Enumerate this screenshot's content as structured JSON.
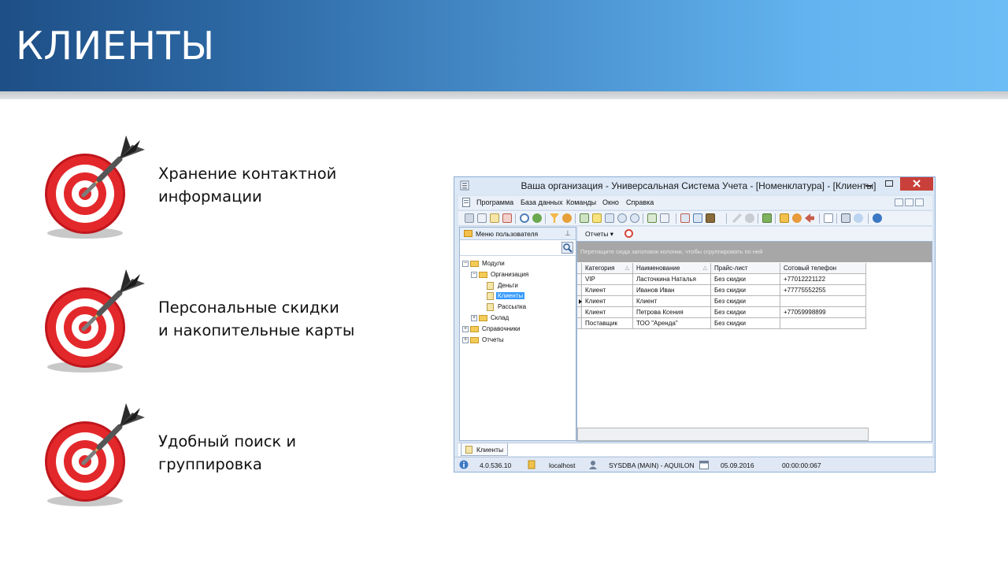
{
  "slide": {
    "title": "КЛИЕНТЫ",
    "bullets": [
      {
        "line1": "Хранение контактной",
        "line2": "информации",
        "icon": "target-dart-icon"
      },
      {
        "line1": "Персональные скидки",
        "line2": "и накопительные карты",
        "icon": "target-dart-icon"
      },
      {
        "line1": "Удобный поиск и",
        "line2": "группировка",
        "icon": "target-dart-icon"
      }
    ]
  },
  "app": {
    "title": "Ваша организация - Универсальная Система Учета - [Номенклатура] - [Клиенты]",
    "menu": [
      "Программа",
      "База данных",
      "Команды",
      "Окно",
      "Справка"
    ],
    "nav_panel": {
      "header": "Меню пользователя",
      "search_value": "",
      "tree": [
        {
          "label": "Модули",
          "level": 0,
          "expander": "−",
          "icon": "folder-open-icon"
        },
        {
          "label": "Организация",
          "level": 1,
          "expander": "−",
          "icon": "folder-open-icon"
        },
        {
          "label": "Деньги",
          "level": 2,
          "expander": "",
          "icon": "document-icon"
        },
        {
          "label": "Клиенты",
          "level": 2,
          "expander": "",
          "icon": "document-icon",
          "selected": true
        },
        {
          "label": "Рассылка",
          "level": 2,
          "expander": "",
          "icon": "document-icon"
        },
        {
          "label": "Склад",
          "level": 1,
          "expander": "+",
          "icon": "folder-icon"
        },
        {
          "label": "Справочники",
          "level": 0,
          "expander": "+",
          "icon": "folder-icon"
        },
        {
          "label": "Отчеты",
          "level": 0,
          "expander": "+",
          "icon": "folder-icon"
        }
      ]
    },
    "reports_label": "Отчеты",
    "group_hint": "Перетащите сюда заголовок колонки, чтобы сгруппировать по ней",
    "grid": {
      "columns": [
        "Категория",
        "Наименование",
        "Прайс-лист",
        "Сотовый телефон"
      ],
      "rows": [
        [
          "VIP",
          "Ласточкина Наталья",
          "Без скидки",
          "+77012221122"
        ],
        [
          "Клиент",
          "Иванов Иван",
          "Без скидки",
          "+77775552255"
        ],
        [
          "Клиент",
          "Клиент",
          "Без скидки",
          ""
        ],
        [
          "Клиент",
          "Петрова Ксения",
          "Без скидки",
          "+77059998899"
        ],
        [
          "Поставщик",
          "ТОО \"Аренда\"",
          "Без скидки",
          ""
        ]
      ],
      "current_row": 2
    },
    "tab_label": "Клиенты",
    "status": {
      "version": "4.0.536.10",
      "server": "localhost",
      "user": "SYSDBA (MAIN) - AQUILON",
      "date": "05.09.2016",
      "timer": "00:00:00:067"
    },
    "colors": {
      "accent_blue": "#2e6aa6",
      "selection": "#3399ff",
      "close_button": "#c9403a",
      "group_bar": "#a7a7a7"
    }
  }
}
